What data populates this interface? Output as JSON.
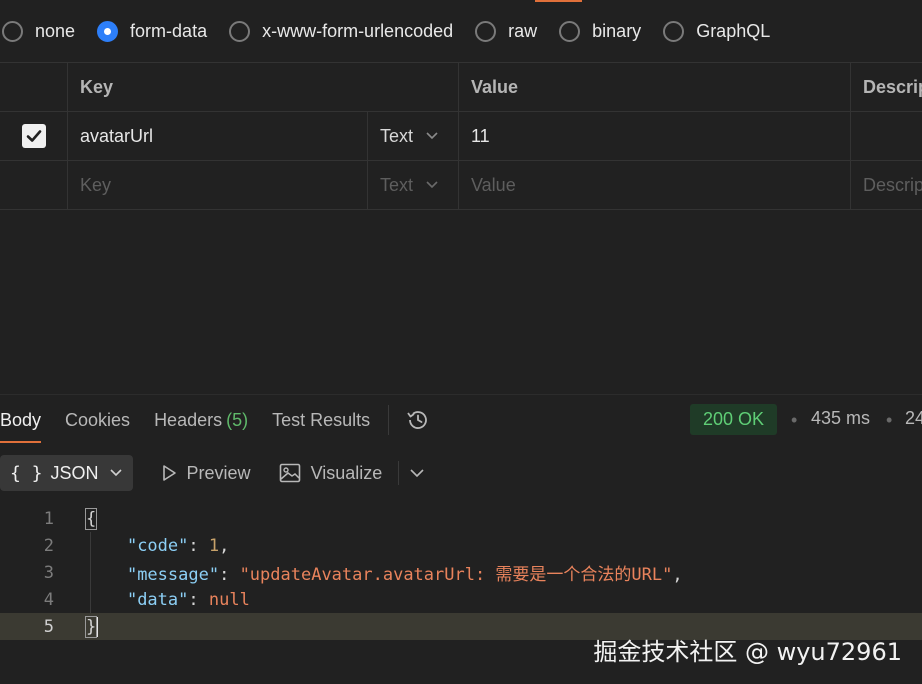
{
  "colors": {
    "background": "#212121",
    "accent": "#e0703a",
    "radio_selected": "#2d7ff9",
    "status_ok": "#5fce76",
    "json_key": "#8ccff5",
    "json_string": "#e9835c"
  },
  "body_types": {
    "options": [
      {
        "label": "none",
        "selected": false
      },
      {
        "label": "form-data",
        "selected": true
      },
      {
        "label": "x-www-form-urlencoded",
        "selected": false
      },
      {
        "label": "raw",
        "selected": false
      },
      {
        "label": "binary",
        "selected": false
      },
      {
        "label": "GraphQL",
        "selected": false
      }
    ]
  },
  "params_table": {
    "headers": {
      "key": "Key",
      "value": "Value",
      "description": "Descrip"
    },
    "rows": [
      {
        "checked": true,
        "key": "avatarUrl",
        "type": "Text",
        "value": "11",
        "description": ""
      }
    ],
    "new_row": {
      "key_placeholder": "Key",
      "type": "Text",
      "value_placeholder": "Value",
      "description_placeholder": "Descrip"
    }
  },
  "response": {
    "tabs": [
      {
        "label": "Body",
        "active": true
      },
      {
        "label": "Cookies",
        "active": false
      },
      {
        "label": "Headers",
        "count": "(5)",
        "active": false
      },
      {
        "label": "Test Results",
        "active": false
      }
    ],
    "history_icon": "history-icon",
    "status": "200 OK",
    "time": "435 ms",
    "size": "24",
    "view_toolbar": {
      "format_icon": "braces-icon",
      "format": "JSON",
      "preview": "Preview",
      "visualize": "Visualize"
    },
    "body_lines": [
      {
        "number": "1",
        "text": "{"
      },
      {
        "number": "2",
        "key": "\"code\"",
        "value": "1"
      },
      {
        "number": "3",
        "key": "\"message\"",
        "value": "\"updateAvatar.avatarUrl: 需要是一个合法的URL\""
      },
      {
        "number": "4",
        "key": "\"data\"",
        "value": "null"
      },
      {
        "number": "5",
        "text": "}"
      }
    ]
  },
  "watermark": "掘金技术社区 @ wyu72961"
}
